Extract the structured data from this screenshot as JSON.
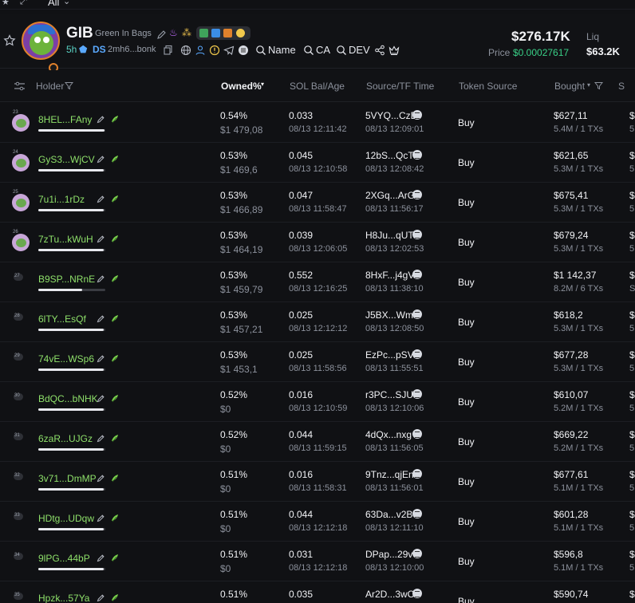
{
  "top": {
    "filter_label": "All"
  },
  "token": {
    "symbol": "GIB",
    "name": "Green In Bags",
    "age": "5h",
    "ds_label": "DS",
    "address_short": "2mh6...bonk",
    "links": {
      "name_label": "Name",
      "ca_label": "CA",
      "dev_label": "DEV"
    },
    "market_cap": "$276.17K",
    "price_label": "Price",
    "price_value": "$0.00027617",
    "liq_label": "Liq",
    "liq_value": "$63.2K",
    "accent_green": "#39d087",
    "holder_green": "#8ee06a"
  },
  "table": {
    "columns": {
      "holder": "Holder",
      "owned": "Owned%",
      "sol": "SOL Bal/Age",
      "source": "Source/TF Time",
      "token_source": "Token Source",
      "bought": "Bought"
    },
    "rows": [
      {
        "rank": "23",
        "holder": "8HEL...FAny",
        "owned": "0.54%",
        "value": "$1 479,08",
        "sol": "0.033",
        "sol_time": "08/13 12:11:42",
        "source": "5VYQ...CzD",
        "source_time": "08/13 12:09:01",
        "token_source": "Buy",
        "bought": "$627,11",
        "bought_sub": "5.4M / 1 TXs",
        "cut": "$",
        "cut_sub": "5",
        "bar_fill": 0.99
      },
      {
        "rank": "24",
        "holder": "GyS3...WjCV",
        "owned": "0.53%",
        "value": "$1 469,6",
        "sol": "0.045",
        "sol_time": "08/13 12:10:58",
        "source": "12bS...QcT",
        "source_time": "08/13 12:08:42",
        "token_source": "Buy",
        "bought": "$621,65",
        "bought_sub": "5.3M / 1 TXs",
        "cut": "$",
        "cut_sub": "5",
        "bar_fill": 0.98
      },
      {
        "rank": "25",
        "holder": "7u1i...1rDz",
        "owned": "0.53%",
        "value": "$1 466,89",
        "sol": "0.047",
        "sol_time": "08/13 11:58:47",
        "source": "2XGq...ArG",
        "source_time": "08/13 11:56:17",
        "token_source": "Buy",
        "bought": "$675,41",
        "bought_sub": "5.3M / 1 TXs",
        "cut": "$",
        "cut_sub": "5",
        "bar_fill": 0.98
      },
      {
        "rank": "26",
        "holder": "7zTu...kWuH",
        "owned": "0.53%",
        "value": "$1 464,19",
        "sol": "0.039",
        "sol_time": "08/13 12:06:05",
        "source": "H8Ju...qUT",
        "source_time": "08/13 12:02:53",
        "token_source": "Buy",
        "bought": "$679,24",
        "bought_sub": "5.3M / 1 TXs",
        "cut": "$",
        "cut_sub": "5",
        "bar_fill": 0.98
      },
      {
        "rank": "27",
        "holder": "B9SP...NRnE",
        "owned": "0.53%",
        "value": "$1 459,79",
        "sol": "0.552",
        "sol_time": "08/13 12:16:25",
        "source": "8HxF...j4gV",
        "source_time": "08/13 11:38:10",
        "token_source": "Buy",
        "bought": "$1 142,37",
        "bought_sub": "8.2M / 6 TXs",
        "cut": "$",
        "cut_sub": "S",
        "bar_fill": 0.66
      },
      {
        "rank": "28",
        "holder": "6lTY...EsQf",
        "owned": "0.53%",
        "value": "$1 457,21",
        "sol": "0.025",
        "sol_time": "08/13 12:12:12",
        "source": "J5BX...Wm",
        "source_time": "08/13 12:08:50",
        "token_source": "Buy",
        "bought": "$618,2",
        "bought_sub": "5.3M / 1 TXs",
        "cut": "$",
        "cut_sub": "5",
        "bar_fill": 0.98
      },
      {
        "rank": "29",
        "holder": "74vE...WSp6",
        "owned": "0.53%",
        "value": "$1 453,1",
        "sol": "0.025",
        "sol_time": "08/13 11:58:56",
        "source": "EzPc...pSV",
        "source_time": "08/13 11:55:51",
        "token_source": "Buy",
        "bought": "$677,28",
        "bought_sub": "5.3M / 1 TXs",
        "cut": "$",
        "cut_sub": "5",
        "bar_fill": 0.98
      },
      {
        "rank": "30",
        "holder": "BdQC...bNHK",
        "owned": "0.52%",
        "value": "$0",
        "sol": "0.016",
        "sol_time": "08/13 12:10:59",
        "source": "r3PC...SJU",
        "source_time": "08/13 12:10:06",
        "token_source": "Buy",
        "bought": "$610,07",
        "bought_sub": "5.2M / 1 TXs",
        "cut": "$",
        "cut_sub": "5",
        "bar_fill": 0.98
      },
      {
        "rank": "31",
        "holder": "6zaR...UJGz",
        "owned": "0.52%",
        "value": "$0",
        "sol": "0.044",
        "sol_time": "08/13 11:59:15",
        "source": "4dQx...nxg",
        "source_time": "08/13 11:56:05",
        "token_source": "Buy",
        "bought": "$669,22",
        "bought_sub": "5.2M / 1 TXs",
        "cut": "$",
        "cut_sub": "5",
        "bar_fill": 0.98
      },
      {
        "rank": "32",
        "holder": "3v71...DmMP",
        "owned": "0.51%",
        "value": "$0",
        "sol": "0.016",
        "sol_time": "08/13 11:58:31",
        "source": "9Tnz...qjEn",
        "source_time": "08/13 11:56:01",
        "token_source": "Buy",
        "bought": "$677,61",
        "bought_sub": "5.1M / 1 TXs",
        "cut": "$",
        "cut_sub": "5",
        "bar_fill": 0.98
      },
      {
        "rank": "33",
        "holder": "HDtg...UDqw",
        "owned": "0.51%",
        "value": "$0",
        "sol": "0.044",
        "sol_time": "08/13 12:12:18",
        "source": "63Da...v2B",
        "source_time": "08/13 12:11:10",
        "token_source": "Buy",
        "bought": "$601,28",
        "bought_sub": "5.1M / 1 TXs",
        "cut": "$",
        "cut_sub": "5",
        "bar_fill": 0.98
      },
      {
        "rank": "34",
        "holder": "9lPG...44bP",
        "owned": "0.51%",
        "value": "$0",
        "sol": "0.031",
        "sol_time": "08/13 12:12:18",
        "source": "DPap...29v",
        "source_time": "08/13 12:10:00",
        "token_source": "Buy",
        "bought": "$596,8",
        "bought_sub": "5.1M / 1 TXs",
        "cut": "$",
        "cut_sub": "5",
        "bar_fill": 0.98
      },
      {
        "rank": "35",
        "holder": "Hpzk...57Ya",
        "owned": "0.51%",
        "value": "",
        "sol": "0.035",
        "sol_time": "",
        "source": "Ar2D...3wC",
        "source_time": "",
        "token_source": "Buy",
        "bought": "$590,74",
        "bought_sub": "",
        "cut": "$",
        "cut_sub": "",
        "bar_fill": 0.98
      }
    ]
  }
}
